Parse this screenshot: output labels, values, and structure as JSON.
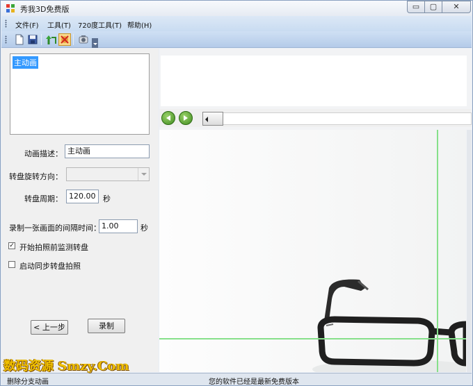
{
  "window": {
    "title": "秀我3D免费版",
    "controls": {
      "minimize": "▭",
      "maximize": "▢",
      "close": "✕"
    }
  },
  "menu": {
    "items": [
      {
        "label": "文件(F)"
      },
      {
        "label": "工具(T)"
      },
      {
        "label": "720度工具(T)"
      },
      {
        "label": "帮助(H)"
      }
    ]
  },
  "toolbar": {
    "icons": [
      "new-file-icon",
      "save-icon",
      "export-icon",
      "delete-icon",
      "camera-icon",
      "overflow-dropdown-icon"
    ]
  },
  "left": {
    "animation_list": {
      "items": [
        "主动画"
      ]
    },
    "fields": {
      "description_label": "动画描述：",
      "description_value": "主动画",
      "rotation_label": "转盘旋转方向：",
      "rotation_value": "",
      "period_label": "转盘周期：",
      "period_value": "120.00",
      "period_unit": "秒",
      "interval_label": "录制一张画面的间隔时间：",
      "interval_value": "1.00",
      "interval_unit": "秒",
      "check_monitor_label": "开始拍照前监测转盘",
      "check_monitor_checked": true,
      "check_sync_label": "启动同步转盘拍照",
      "check_sync_checked": false
    },
    "buttons": {
      "prev": "< 上一步",
      "record": "录制"
    }
  },
  "status": {
    "left": "删除分支动画",
    "middle": "您的软件已经是最新免费版本"
  },
  "watermark": "数码资源 Smzy.Com",
  "colors": {
    "guide_line": "#86e08a",
    "selection": "#3399ff",
    "nav_green": "#3f8a1f"
  }
}
